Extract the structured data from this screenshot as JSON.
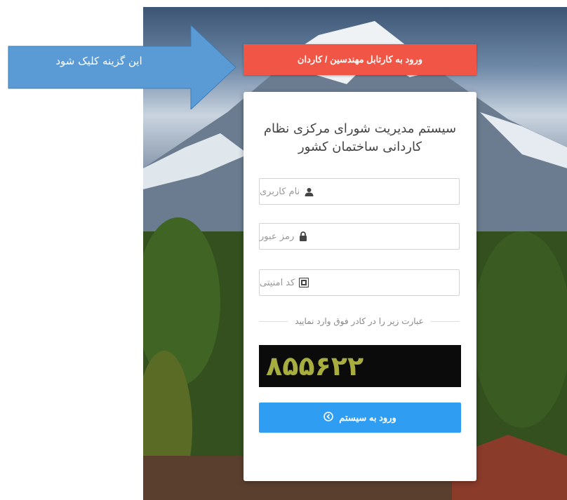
{
  "annotation": {
    "text": "این گزینه کلیک شود"
  },
  "engineers_login": {
    "label": "ورود به کارتابل مهندسین / کاردان"
  },
  "login_card": {
    "title_line1": "سیستم مدیریت شورای مرکزی نظام",
    "title_line2": "کاردانی ساختمان کشور",
    "username": {
      "placeholder": "نام کاربری",
      "icon": "user-icon"
    },
    "password": {
      "placeholder": "رمز عبور",
      "icon": "lock-icon"
    },
    "security_code": {
      "placeholder": "کد امنیتی",
      "icon": "security-code-icon"
    },
    "captcha_instruction": "عبارت زیر را در کادر فوق وارد نمایید",
    "captcha_code": "۸۵۵۶۲۲",
    "submit_label": "ورود به سیستم",
    "submit_icon": "chevron-circle-left-icon"
  },
  "colors": {
    "red_button": "#f05545",
    "blue_button": "#2f9ef2",
    "arrow": "#5b9bd5",
    "captcha_text": "#a7ad3e"
  }
}
